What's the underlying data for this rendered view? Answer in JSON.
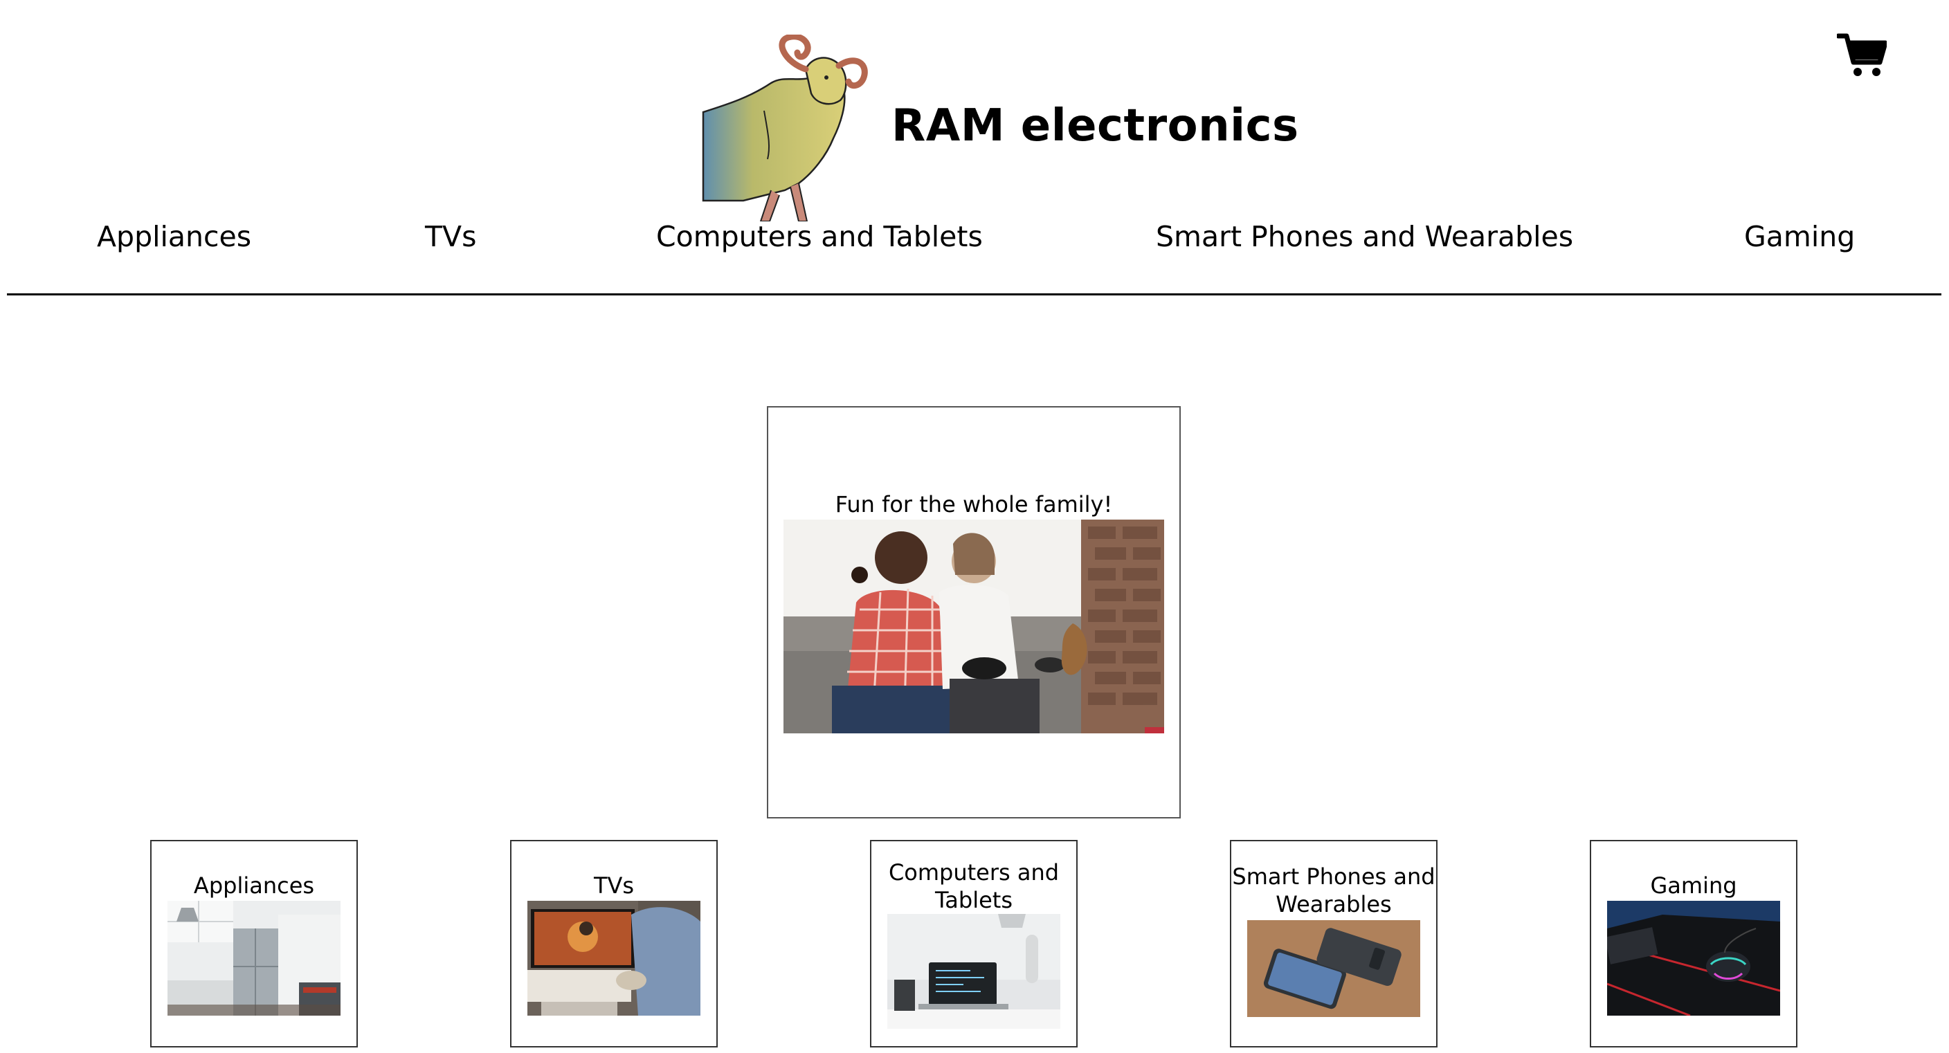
{
  "header": {
    "brand": "RAM electronics",
    "logo_icon": "ram-logo-icon",
    "cart_icon": "shopping-cart-icon"
  },
  "nav": {
    "items": [
      {
        "label": "Appliances"
      },
      {
        "label": "TVs"
      },
      {
        "label": "Computers and Tablets"
      },
      {
        "label": "Smart Phones and Wearables"
      },
      {
        "label": "Gaming"
      }
    ]
  },
  "hero": {
    "caption": "Fun for the whole family!"
  },
  "categories": [
    {
      "label": "Appliances"
    },
    {
      "label": "TVs"
    },
    {
      "label": "Computers and Tablets"
    },
    {
      "label": "Smart Phones and Wearables"
    },
    {
      "label": "Gaming"
    }
  ]
}
